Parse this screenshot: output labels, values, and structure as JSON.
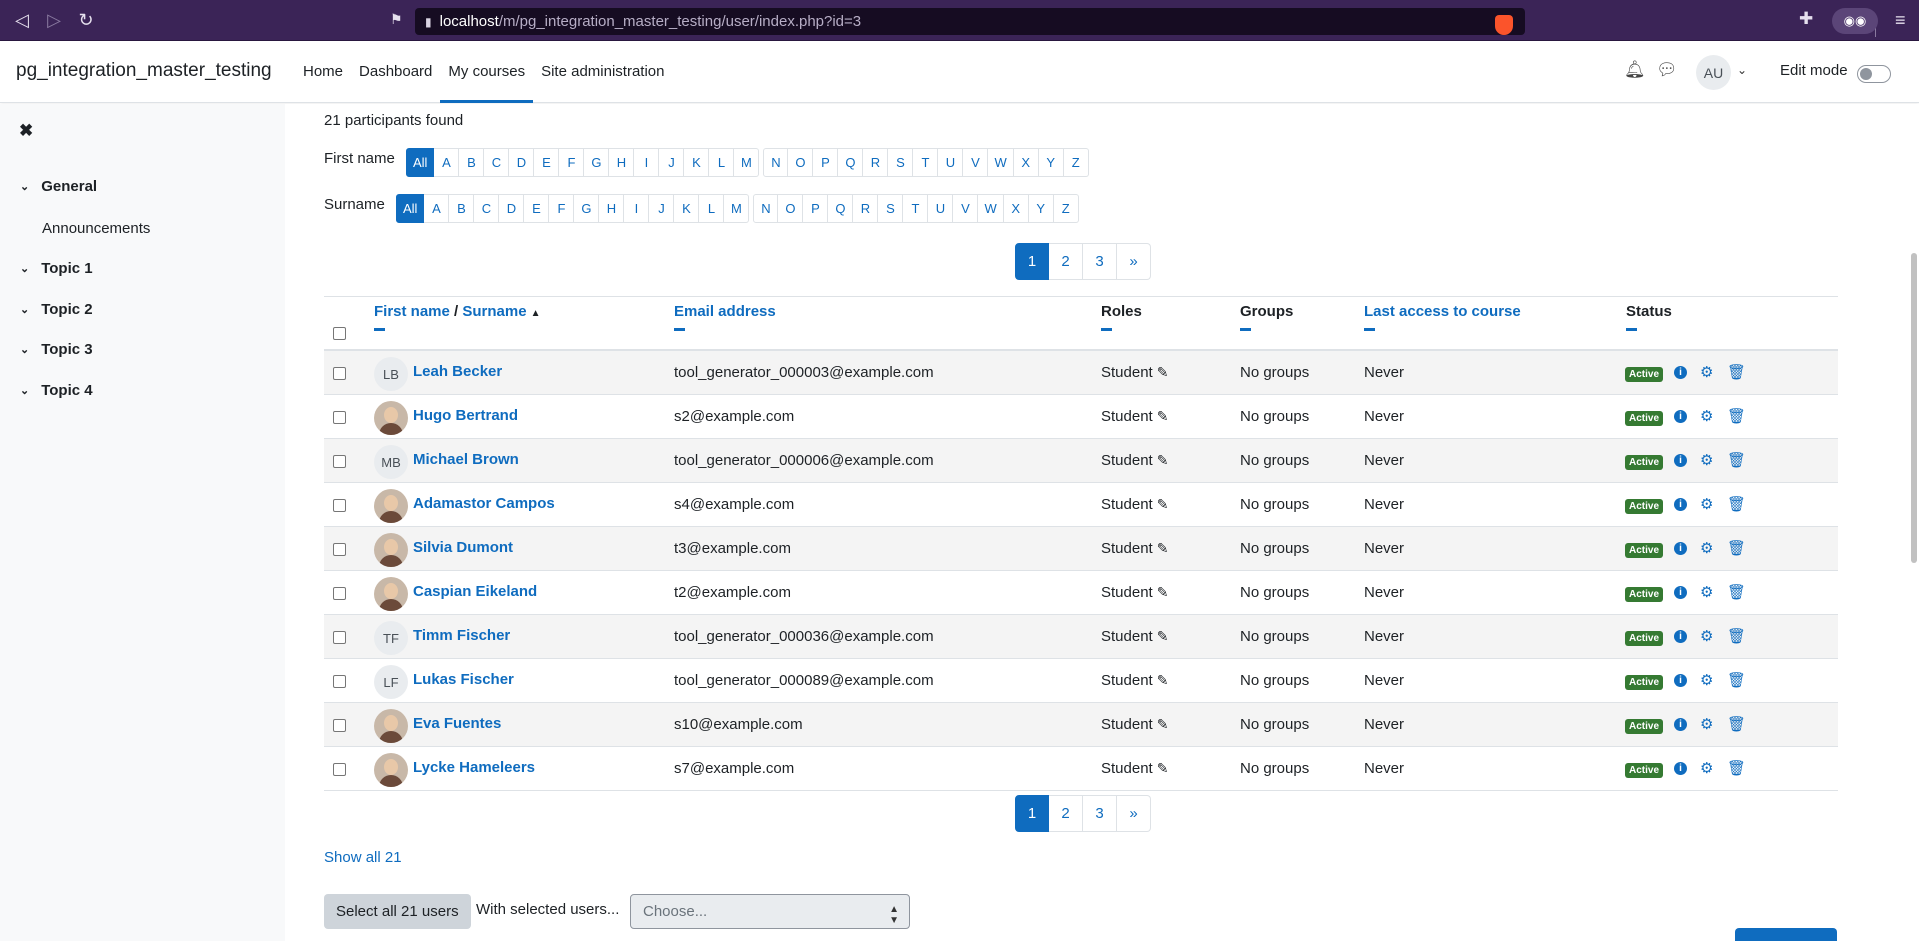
{
  "browser": {
    "url_host": "localhost",
    "url_path": "/m/pg_integration_master_testing/user/index.php?id=3"
  },
  "navbar": {
    "site_name": "pg_integration_master_testing",
    "links": [
      "Home",
      "Dashboard",
      "My courses",
      "Site administration"
    ],
    "active_link": "My courses",
    "user_initials": "AU",
    "edit_mode_label": "Edit mode"
  },
  "drawer": {
    "sections": [
      {
        "label": "General",
        "items": [
          "Announcements"
        ]
      },
      {
        "label": "Topic 1",
        "items": []
      },
      {
        "label": "Topic 2",
        "items": []
      },
      {
        "label": "Topic 3",
        "items": []
      },
      {
        "label": "Topic 4",
        "items": []
      }
    ]
  },
  "participants": {
    "found_text": "21 participants found",
    "firstname_label": "First name",
    "surname_label": "Surname",
    "all_label": "All",
    "letters": [
      "A",
      "B",
      "C",
      "D",
      "E",
      "F",
      "G",
      "H",
      "I",
      "J",
      "K",
      "L",
      "M",
      "N",
      "O",
      "P",
      "Q",
      "R",
      "S",
      "T",
      "U",
      "V",
      "W",
      "X",
      "Y",
      "Z"
    ],
    "pages": [
      "1",
      "2",
      "3",
      "»"
    ],
    "current_page": "1",
    "columns": {
      "firstname": "First name",
      "slash": "/",
      "surname": "Surname",
      "email": "Email address",
      "roles": "Roles",
      "groups": "Groups",
      "last_access": "Last access to course",
      "status": "Status"
    },
    "rows": [
      {
        "initials": "LB",
        "photo": false,
        "name": "Leah Becker",
        "email": "tool_generator_000003@example.com",
        "role": "Student",
        "groups": "No groups",
        "last_access": "Never",
        "status": "Active"
      },
      {
        "initials": "",
        "photo": true,
        "name": "Hugo Bertrand",
        "email": "s2@example.com",
        "role": "Student",
        "groups": "No groups",
        "last_access": "Never",
        "status": "Active"
      },
      {
        "initials": "MB",
        "photo": false,
        "name": "Michael Brown",
        "email": "tool_generator_000006@example.com",
        "role": "Student",
        "groups": "No groups",
        "last_access": "Never",
        "status": "Active"
      },
      {
        "initials": "",
        "photo": true,
        "name": "Adamastor Campos",
        "email": "s4@example.com",
        "role": "Student",
        "groups": "No groups",
        "last_access": "Never",
        "status": "Active"
      },
      {
        "initials": "",
        "photo": true,
        "name": "Silvia Dumont",
        "email": "t3@example.com",
        "role": "Student",
        "groups": "No groups",
        "last_access": "Never",
        "status": "Active"
      },
      {
        "initials": "",
        "photo": true,
        "name": "Caspian Eikeland",
        "email": "t2@example.com",
        "role": "Student",
        "groups": "No groups",
        "last_access": "Never",
        "status": "Active"
      },
      {
        "initials": "TF",
        "photo": false,
        "name": "Timm Fischer",
        "email": "tool_generator_000036@example.com",
        "role": "Student",
        "groups": "No groups",
        "last_access": "Never",
        "status": "Active"
      },
      {
        "initials": "LF",
        "photo": false,
        "name": "Lukas Fischer",
        "email": "tool_generator_000089@example.com",
        "role": "Student",
        "groups": "No groups",
        "last_access": "Never",
        "status": "Active"
      },
      {
        "initials": "",
        "photo": true,
        "name": "Eva Fuentes",
        "email": "s10@example.com",
        "role": "Student",
        "groups": "No groups",
        "last_access": "Never",
        "status": "Active"
      },
      {
        "initials": "",
        "photo": true,
        "name": "Lycke Hameleers",
        "email": "s7@example.com",
        "role": "Student",
        "groups": "No groups",
        "last_access": "Never",
        "status": "Active"
      }
    ],
    "show_all": "Show all 21",
    "select_all_button": "Select all 21 users",
    "with_selected_label": "With selected users...",
    "choose_placeholder": "Choose..."
  },
  "colors": {
    "brand": "#0f6cbf",
    "active_badge": "#357a32",
    "browser_bar": "#3b2457"
  }
}
